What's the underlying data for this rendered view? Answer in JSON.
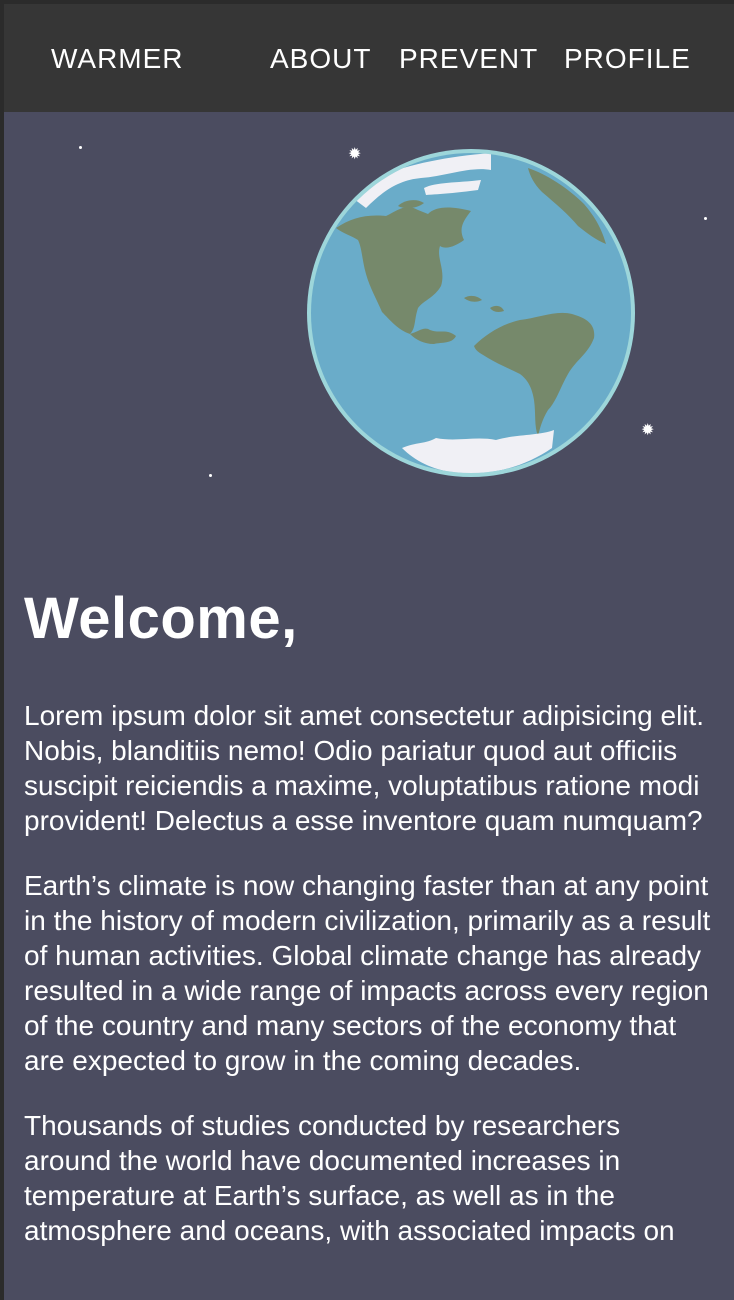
{
  "nav": {
    "brand": "WARMER",
    "links": [
      "ABOUT",
      "PREVENT",
      "PROFILE"
    ]
  },
  "hero": {
    "illustration": "earth-globe",
    "colors": {
      "background": "#4b4c60",
      "ocean": "#6aacc9",
      "land": "#76896b",
      "ice": "#f0f0f5",
      "rim": "#9dd6da"
    }
  },
  "content": {
    "heading": "Welcome,",
    "paragraphs": [
      "Lorem ipsum dolor sit amet consectetur adipisicing elit. Nobis, blanditiis nemo! Odio pariatur quod aut officiis suscipit reiciendis a maxime, voluptatibus ratione modi provident! Delectus a esse inventore quam numquam?",
      "Earth’s climate is now changing faster than at any point in the history of modern civilization, primarily as a result of human activities. Global climate change has already resulted in a wide range of impacts across every region of the country and many sectors of the economy that are expected to grow in the coming decades.",
      "Thousands of studies conducted by researchers around the world have documented increases in temperature at Earth’s surface, as well as in the atmosphere and oceans, with associated impacts on"
    ]
  },
  "colors": {
    "navbar": "#363636",
    "page": "#4b4c60",
    "text": "#ffffff"
  }
}
